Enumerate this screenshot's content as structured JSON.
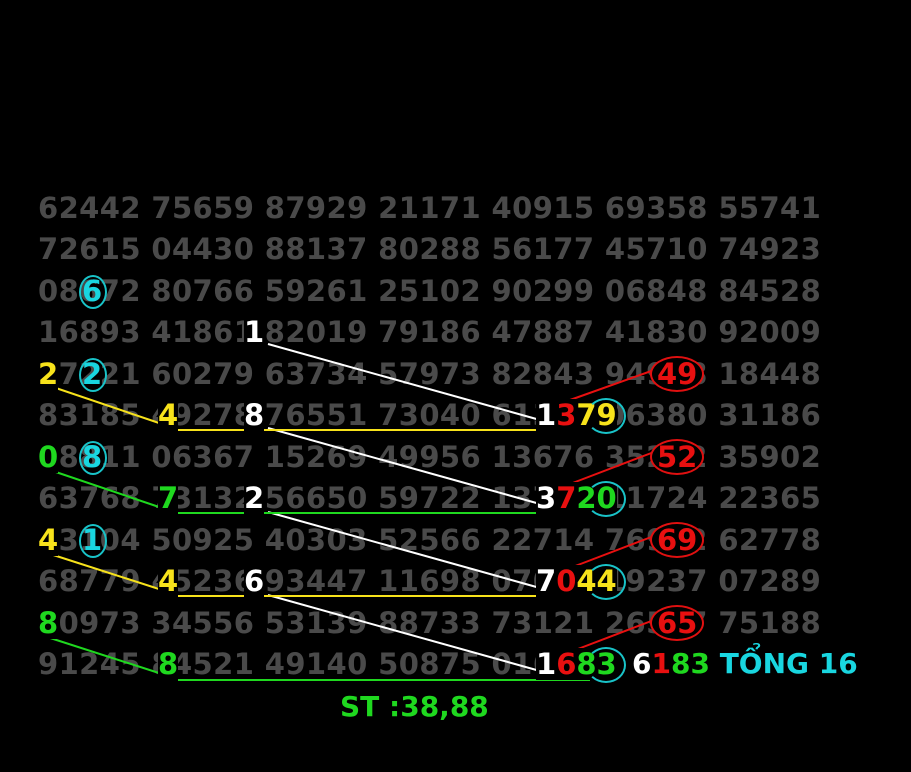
{
  "grid_rows": [
    "62442 75659 87929 21171 40915 69358 55741",
    "72615 04430 88137 80288 56177 45710 74923",
    "08672 80766 59261 25102 90299 06848 84528",
    "16893 41861 82019 79186 47887 41830 92009",
    "27221 60279 63734 57973 82843 94958 18448",
    "83185 49278 76551 73040 61379 06380 31186",
    "08811 06367 15269 49956 13676 35252 35902",
    "63768 73132 56650 59722 13720 11724 22365",
    "43104 50925 40303 52566 22714 76922 62778",
    "68779 45236 93447 11698 07044 19237 07289",
    "80973 34556 53139 88733 73121 26547 75188",
    "91245 84521 49140 50875 01683 ",
    ""
  ],
  "highlights": {
    "circled_cyan": [
      "6",
      "2",
      "8",
      "1"
    ],
    "white_digits": [
      "1",
      "8",
      "2",
      "6"
    ],
    "yellow_digits": [
      "2",
      "4",
      "4",
      "4"
    ],
    "green_digits": [
      "0",
      "7",
      "8",
      "8"
    ],
    "results": [
      {
        "w": "1",
        "r": "3",
        "t": "79"
      },
      {
        "w": "3",
        "r": "7",
        "t": "20"
      },
      {
        "w": "7",
        "r": "0",
        "t": "44"
      },
      {
        "w": "1",
        "r": "6",
        "t": "83"
      }
    ],
    "red_pairs": [
      "49",
      "52",
      "69",
      "65"
    ]
  },
  "summary": {
    "d1": "6",
    "d2": "1",
    "d3": "83",
    "label": "TỔNG 16"
  },
  "footer": "ST :38,88",
  "colors": {
    "background": "#000000",
    "grid_text": "#4a4a4a",
    "white": "#ffffff",
    "yellow": "#f7e21b",
    "green": "#1fd81f",
    "red": "#e81010",
    "cyan": "#19d6e0"
  }
}
